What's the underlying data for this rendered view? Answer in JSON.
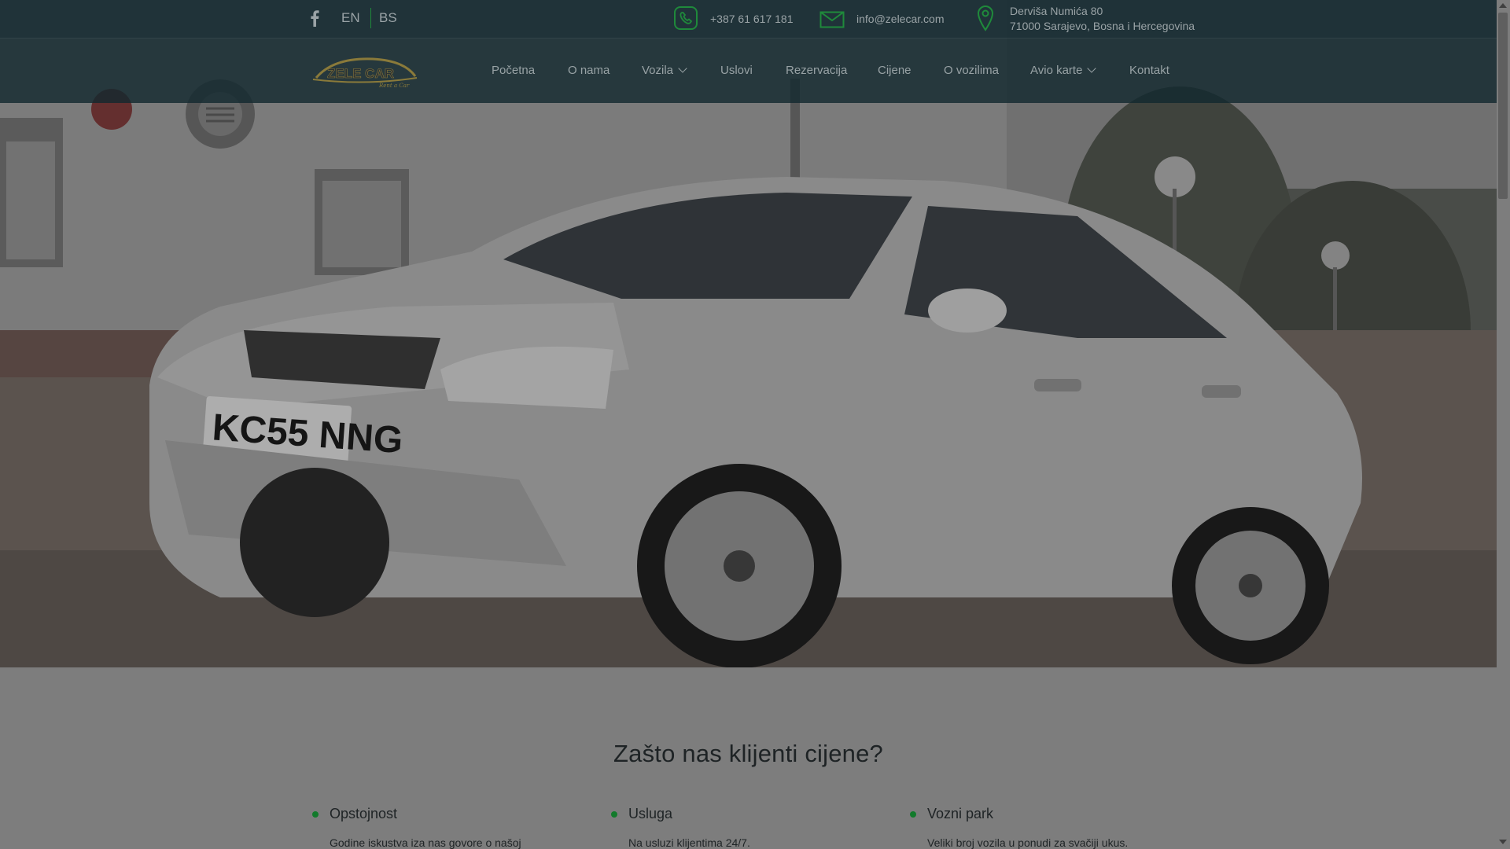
{
  "header": {
    "social": {
      "facebook_icon": "facebook-icon"
    },
    "languages": [
      {
        "label": "EN"
      },
      {
        "label": "BS"
      }
    ],
    "phone": {
      "icon": "phone-icon",
      "text": "+387 61 617 181"
    },
    "email": {
      "icon": "mail-icon",
      "text": "info@zelecar.com"
    },
    "address": {
      "icon": "location-pin-icon",
      "line1": "Derviša Numića 80",
      "line2": "71000 Sarajevo, Bosna i Hercegovina"
    }
  },
  "logo": {
    "text": "ZELE CAR",
    "subtext": "Rent a Car"
  },
  "nav": {
    "items": [
      {
        "label": "Početna"
      },
      {
        "label": "O nama"
      },
      {
        "label": "Vozila",
        "dropdown": true
      },
      {
        "label": "Uslovi"
      },
      {
        "label": "Rezervacija"
      },
      {
        "label": "Cijene"
      },
      {
        "label": "O vozilima"
      },
      {
        "label": "Avio karte",
        "dropdown": true
      },
      {
        "label": "Kontakt"
      }
    ]
  },
  "hero": {
    "plate": "KC55 NNG"
  },
  "why": {
    "title": "Zašto nas klijenti cijene?",
    "features": [
      {
        "title": "Opstojnost",
        "desc": "Godine iskustva iza nas govore o našoj"
      },
      {
        "title": "Usluga",
        "desc": "Na usluzi klijentima 24/7."
      },
      {
        "title": "Vozni park",
        "desc": "Veliki broj vozila u ponudi za svačiji ukus."
      }
    ]
  },
  "colors": {
    "header_bg": "#12282e",
    "accent_green": "#1f8a3b",
    "bullet_green": "#127a2b",
    "title_text": "#1e2325",
    "overlay_gray": "#7d7d7d"
  }
}
